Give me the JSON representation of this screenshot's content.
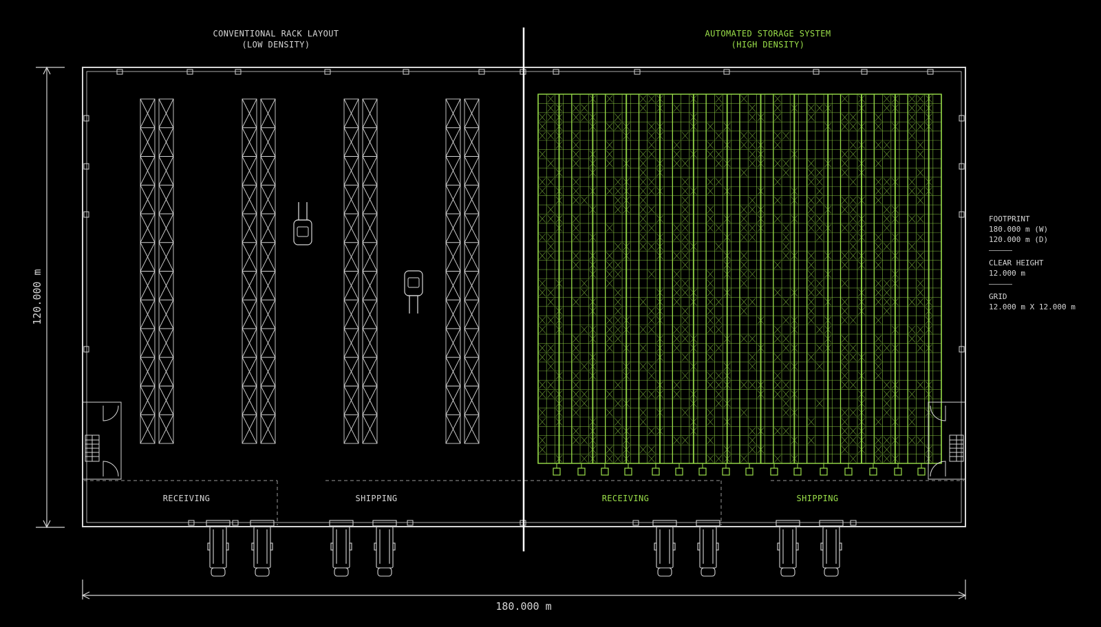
{
  "colors": {
    "background": "#000000",
    "linework": "#d6d6d6",
    "accent": "#9be04a",
    "divider": "#ffffff"
  },
  "titles": {
    "left_line1": "CONVENTIONAL RACK LAYOUT",
    "left_line2": "(LOW DENSITY)",
    "right_line1": "AUTOMATED STORAGE SYSTEM",
    "right_line2": "(HIGH DENSITY)"
  },
  "zones": {
    "left_receiving": "RECEIVING",
    "left_shipping": "SHIPPING",
    "right_receiving": "RECEIVING",
    "right_shipping": "SHIPPING"
  },
  "dimensions": {
    "width": "180.000 m",
    "depth": "120.000 m"
  },
  "specs": {
    "footprint_label": "FOOTPRINT",
    "footprint_w": "180.000 m (W)",
    "footprint_d": "120.000 m (D)",
    "clear_height_label": "CLEAR HEIGHT",
    "clear_height_value": "12.000 m",
    "grid_label": "GRID",
    "grid_value": "12.000 m X 12.000 m"
  },
  "icons": [
    "forklift-icon",
    "truck-icon",
    "stair-icon",
    "door-swing-icon"
  ]
}
